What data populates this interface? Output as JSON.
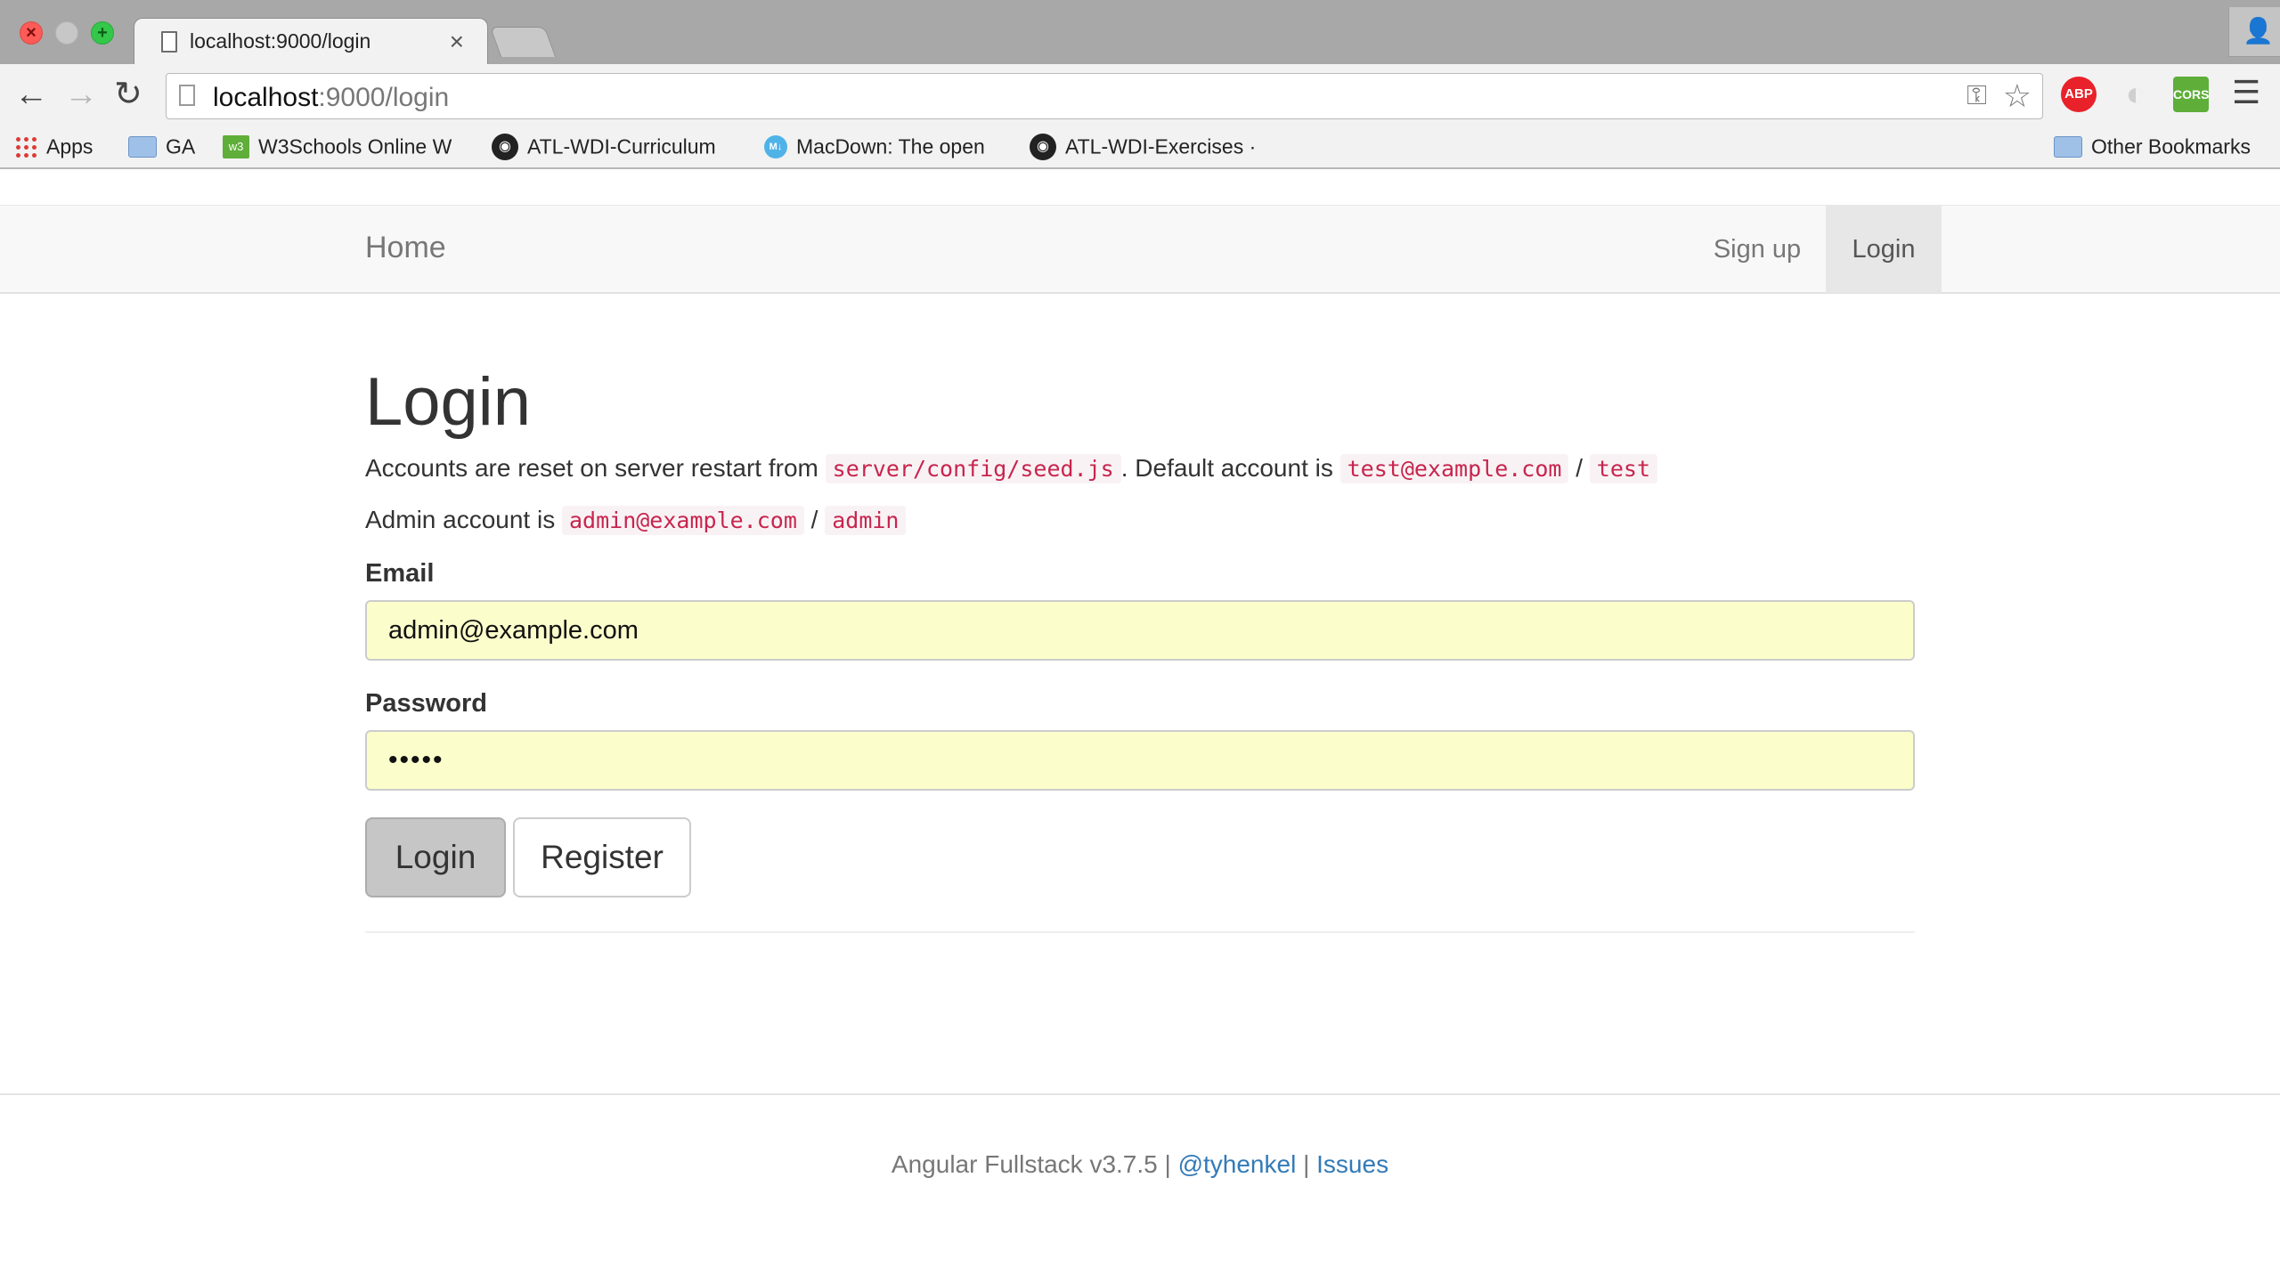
{
  "browser": {
    "tab_title": "localhost:9000/login",
    "tab_close": "×",
    "url_host": "localhost",
    "url_rest": ":9000/login",
    "extensions": {
      "abp_label": "ABP",
      "cors_label": "CORS"
    },
    "bookmarks": [
      {
        "label": "Apps",
        "icon": "apps-grid-icon"
      },
      {
        "label": "GA",
        "icon": "folder-icon"
      },
      {
        "label": "W3Schools Online W",
        "icon": "w3schools-icon"
      },
      {
        "label": "ATL-WDI-Curriculum",
        "icon": "github-icon"
      },
      {
        "label": "MacDown: The open",
        "icon": "macdown-icon"
      },
      {
        "label": "ATL-WDI-Exercises ·",
        "icon": "github-icon"
      }
    ],
    "other_bookmarks": "Other Bookmarks"
  },
  "navbar": {
    "brand": "Home",
    "links": [
      {
        "label": "Sign up",
        "active": false
      },
      {
        "label": "Login",
        "active": true
      }
    ]
  },
  "main": {
    "title": "Login",
    "line1": {
      "prefix": "Accounts are reset on server restart from ",
      "code_path": "server/config/seed.js",
      "middle": ". Default account is ",
      "code_email": "test@example.com",
      "sep": " / ",
      "code_pass": "test"
    },
    "line2": {
      "prefix": "Admin account is ",
      "code_email": "admin@example.com",
      "sep": " / ",
      "code_pass": "admin"
    },
    "email_label": "Email",
    "email_value": "admin@example.com",
    "password_label": "Password",
    "password_value": "•••••",
    "login_button": "Login",
    "register_button": "Register"
  },
  "footer": {
    "text": "Angular Fullstack v3.7.5 | ",
    "author_link": "@tyhenkel",
    "sep": " | ",
    "issues_link": "Issues"
  },
  "colors": {
    "autofill_bg": "#fbfecb",
    "code_color": "#c7254e",
    "link_color": "#337ab7"
  }
}
